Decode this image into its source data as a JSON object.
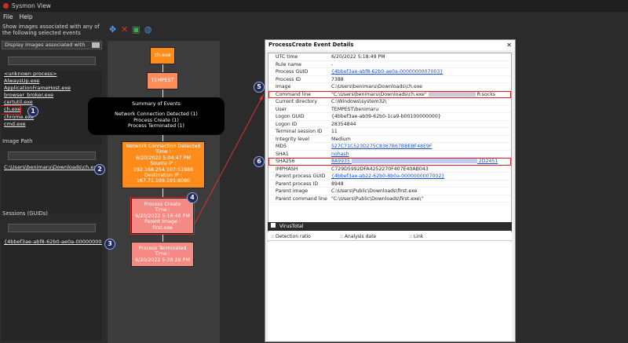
{
  "app": {
    "title": "Sysmon View",
    "menu": [
      "File",
      "Help"
    ]
  },
  "left": {
    "intro": "Show images associated with any of the following selected events",
    "display_label": "Display images associated with",
    "processes": [
      "<unknown process>",
      "AlwaysUp.exe",
      "ApplicationFrameHost.exe",
      "browser_broker.exe",
      "certutil.exe",
      "ch.exe",
      "chrome.exe",
      "cmd.exe"
    ],
    "image_path_label": "Image Path",
    "image_path_value": "C:\\Users\\benimaru\\Downloads\\ch.exe",
    "sessions_label": "Sessions (GUIDs)",
    "session_value": "{4bbef3ae-abf8-62b0-ae0a-0000000007"
  },
  "badges": [
    "1",
    "2",
    "3",
    "4",
    "5",
    "6"
  ],
  "graph": {
    "node1": "ch.exe",
    "node2": "TEMPEST",
    "summary": [
      "Summary of Events",
      "Network Connection Detected (1)",
      "Process Create (1)",
      "Process Terminated (1)"
    ],
    "net": [
      "Network Connection Detected",
      "Time :",
      "6/20/2022 5:04:47 PM",
      "Source IP :",
      "192.168.254.107:51988",
      "Destination IP :",
      "167.71.199.191:8080"
    ],
    "pc": [
      "Process Create",
      "Time :",
      "6/20/2022 5:18:48 PM",
      "Parent Image :",
      "first.exe"
    ],
    "pt": [
      "Process Terminated",
      "Time :",
      "6/20/2022 5:28:28 PM"
    ]
  },
  "dialog": {
    "title": "ProcessCreate Event Details",
    "rows": [
      {
        "k": "UTC time",
        "v": "6/20/2022 5:18:49 PM"
      },
      {
        "k": "Rule name",
        "v": "-"
      },
      {
        "k": "Process GUID",
        "v": "{4bbef3ae-abf8-62b0-ae0a-0000000007003}",
        "link": true
      },
      {
        "k": "Process ID",
        "v": "7388"
      },
      {
        "k": "Image",
        "v": "C:\\Users\\benimaru\\Downloads\\ch.exe"
      },
      {
        "k": "Command line",
        "v": "\"C:\\Users\\benimaru\\Downloads\\ch.exe\"",
        "v2": "R:socks"
      },
      {
        "k": "Current directory",
        "v": "C:\\Windows\\system32\\"
      },
      {
        "k": "User",
        "v": "TEMPEST\\benimaru"
      },
      {
        "k": "Logon GUID",
        "v": "{4bbef3ae-ab09-62b0-1ca9-b00100000000}"
      },
      {
        "k": "Logon ID",
        "v": "28354844"
      },
      {
        "k": "Terminal session ID",
        "v": "11"
      },
      {
        "k": "Integrity level",
        "v": "Medium"
      },
      {
        "k": "MD5",
        "v": "527C71C523D275C8367B67BBEBF48E9F",
        "link": true
      },
      {
        "k": "SHA1",
        "v": "nohash",
        "link": true
      },
      {
        "k": "SHA256",
        "v": "8A9935",
        "v2": "2D2451",
        "link": true
      },
      {
        "k": "IMPHASH",
        "v": "C729D5992DFA4252270F407E40AB043"
      },
      {
        "k": "Parent process GUID",
        "v": "{4bbef3ae-ab22-62b0-8b0a-0000000007002}",
        "link": true
      },
      {
        "k": "Parent process ID",
        "v": "8948"
      },
      {
        "k": "Parent image",
        "v": "C:\\Users\\Public\\Downloads\\first.exe"
      },
      {
        "k": "Parent command line",
        "v": "\"C:\\Users\\Public\\Downloads\\first.exe\\\""
      }
    ],
    "vt_label": "VirusTotal",
    "vt_cols": [
      ":: Detection ratio",
      ":: Analysis date",
      ":: Link"
    ]
  }
}
